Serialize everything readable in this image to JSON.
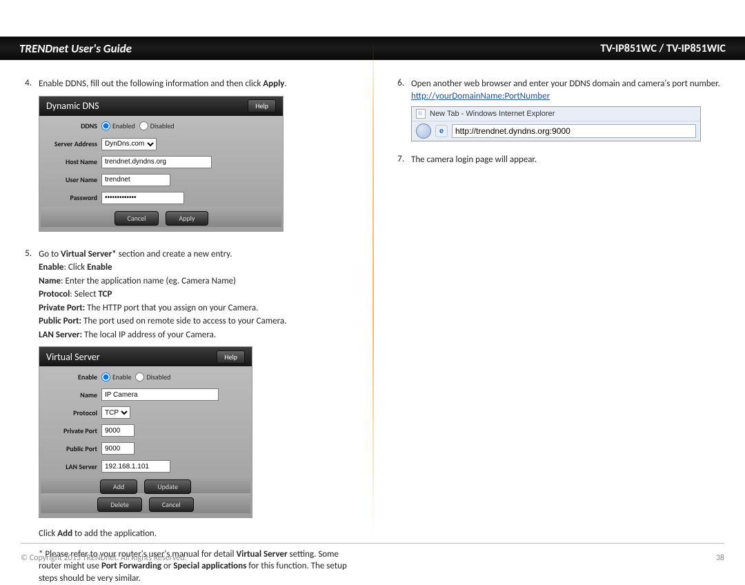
{
  "header": {
    "left_title": "TRENDnet User's Guide",
    "right_title": "TV-IP851WC / TV-IP851WIC"
  },
  "help_label": "Help",
  "left": {
    "step4": {
      "num": "4.",
      "text_prefix": "Enable DDNS, fill out the following information and then click ",
      "apply_label": "Apply",
      "text_suffix": "."
    },
    "ddns_panel": {
      "title": "Dynamic DNS",
      "rows": {
        "ddns_label": "DDNS",
        "server_label": "Server Address",
        "host_label": "Host Name",
        "user_label": "User Name",
        "pw_label": "Password"
      },
      "values": {
        "enabled_opt": "Enabled",
        "disabled_opt": "Disabled",
        "enabled_selected": true,
        "server": "DynDns.com",
        "host": "trendnet.dyndns.org",
        "user": "trendnet",
        "password_masked": "•••••••••••••"
      },
      "buttons": {
        "cancel": "Cancel",
        "apply": "Apply"
      }
    },
    "step5": {
      "num": "5.",
      "intro_prefix": "Go to ",
      "virtual_server_bold": "Virtual Server*",
      "intro_suffix": " section and create a new entry.",
      "lines": {
        "enable_b": "Enable",
        "enable_mid": ": Click ",
        "enable_b2": "Enable",
        "name_b": "Name",
        "name_rest": ": Enter the application name (eg. Camera Name)",
        "protocol_b": "Protocol",
        "protocol_mid": ": Select ",
        "protocol_b2": "TCP",
        "private_b": "Private Port:",
        "private_rest": " The HTTP port that you assign on your Camera.",
        "public_b": "Public Port:",
        "public_rest": " The port used on remote side to access to your Camera.",
        "lan_b": "LAN Server:",
        "lan_rest": " The local IP address of your Camera."
      }
    },
    "vs_panel": {
      "title": "Virtual Server",
      "rows": {
        "enable": "Enable",
        "name": "Name",
        "protocol": "Protocol",
        "private_port": "Private Port",
        "public_port": "Public Port",
        "lan_server": "LAN Server"
      },
      "values": {
        "enable_selected": true,
        "enable_opt": "Enable",
        "disabled_opt": "Disabled",
        "name": "IP Camera",
        "protocol": "TCP",
        "private_port": "9000",
        "public_port": "9000",
        "lan_server": "192.168.1.101"
      },
      "buttons": {
        "add": "Add",
        "update": "Update",
        "delete": "Delete",
        "cancel": "Cancel"
      }
    },
    "click_add_prefix": "Click ",
    "click_add_bold": "Add",
    "click_add_suffix": " to add the application.",
    "note_prefix": "* Please refer to your router's user's manual for detail ",
    "note_vs_bold": "Virtual Server",
    "note_mid1": " setting.  Some router might use ",
    "note_pf_bold": "Port Forwarding",
    "note_or": " or ",
    "note_sa_bold": "Special applications",
    "note_suffix": " for this function.  The setup steps should be very similar."
  },
  "right": {
    "step6": {
      "num": "6.",
      "text": "Open another web browser and enter your DDNS domain and camera's port number.",
      "link": "http://yourDomainName:PortNumber"
    },
    "iebar": {
      "title": "New Tab - Windows Internet Explorer",
      "address": "http://trendnet.dyndns.org:9000"
    },
    "step7": {
      "num": "7.",
      "text": "The camera login page will appear."
    }
  },
  "footer": {
    "copyright": "© Copyright 2013 TRENDnet. All Rights Reserved.",
    "page": "38"
  }
}
